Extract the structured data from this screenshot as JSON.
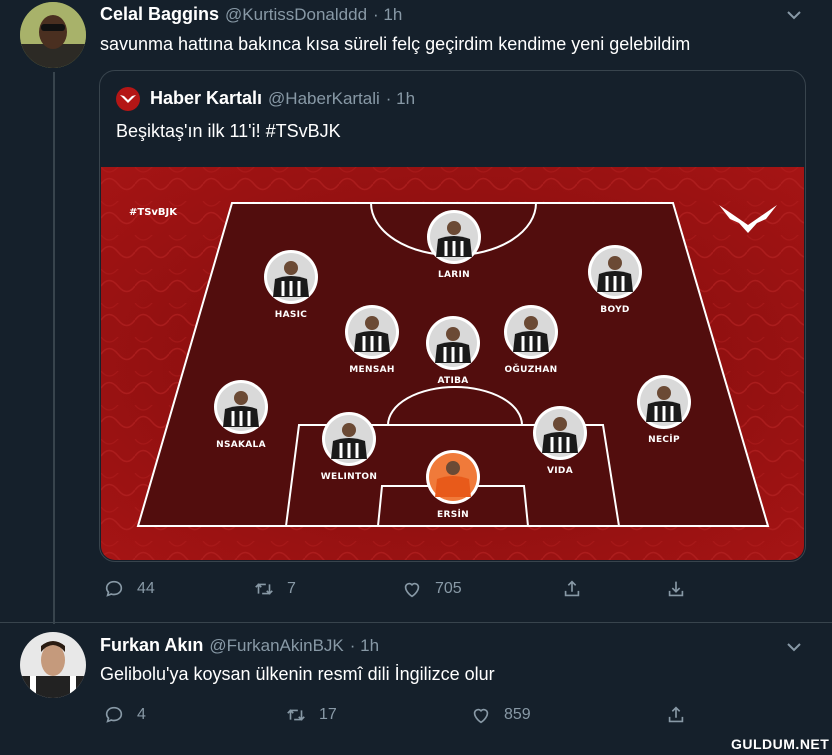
{
  "tweet1": {
    "name": "Celal Baggins",
    "handle": "@KurtissDonalddd",
    "time": "· 1h",
    "text": "savunma hattına bakınca kısa süreli felç geçirdim kendime yeni gelebildim"
  },
  "quote": {
    "name": "Haber Kartalı",
    "handle": "@HaberKartali",
    "time": "· 1h",
    "text": "Beşiktaş'ın ilk 11'i! #TSvBJK",
    "image": {
      "hashtag": "#TSvBJK",
      "players": [
        "LARIN",
        "HASIC",
        "BOYD",
        "MENSAH",
        "ATIBA",
        "OĞUZHAN",
        "NSAKALA",
        "NECİP",
        "WELINTON",
        "VIDA",
        "ERSİN"
      ]
    }
  },
  "tweet1_actions": {
    "reply": "44",
    "retweet": "7",
    "like": "705"
  },
  "tweet2": {
    "name": "Furkan Akın",
    "handle": "@FurkanAkinBJK",
    "time": "· 1h",
    "text": "Gelibolu'ya koysan ülkenin resmî dili İngilizce olur"
  },
  "tweet2_actions": {
    "reply": "4",
    "retweet": "17",
    "like": "859"
  },
  "watermark": "GULDUM.NET",
  "icons": [
    "chevron-down-icon",
    "reply-icon",
    "retweet-icon",
    "like-icon",
    "share-icon",
    "download-icon",
    "eagle-logo-icon"
  ],
  "colors": {
    "background": "#15202b",
    "muted": "#8899a6",
    "border": "#38444d",
    "pitch_red": "#8b0e0e"
  }
}
